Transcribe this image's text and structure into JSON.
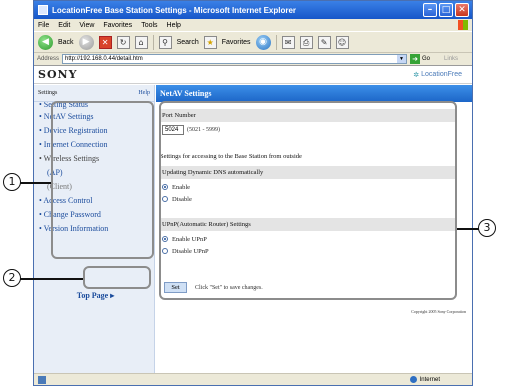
{
  "window": {
    "title": "LocationFree Base Station Settings - Microsoft Internet Explorer",
    "controls": {
      "minimize": "–",
      "maximize": "□",
      "close": "✕"
    }
  },
  "menubar": {
    "items": [
      "File",
      "Edit",
      "View",
      "Favorites",
      "Tools",
      "Help"
    ]
  },
  "toolbar": {
    "back": "Back",
    "search": "Search",
    "favorites": "Favorites"
  },
  "addressbar": {
    "label": "Address",
    "url": "http://192.168.0.44/detail.htm",
    "go": "Go",
    "links": "Links"
  },
  "brand": {
    "left": "SONY",
    "right": "LocationFree"
  },
  "sidebar": {
    "title": "Settings",
    "help": "Help",
    "items": [
      "• Setting Status",
      "• NetAV Settings",
      "• Device Registration",
      "• Internet Connection",
      "• Wireless Settings",
      "(AP)",
      "(Client)",
      "• Access Control",
      "• Change Password",
      "• Version Information"
    ],
    "top_page": "Top Page ▸"
  },
  "main": {
    "heading": "NetAV Settings",
    "port": {
      "title": "Port Number",
      "value": "5024",
      "range": "(5021 - 5999)"
    },
    "outside_title": "Settings for accessing to the Base Station from outside",
    "ddns": {
      "title": "Updating Dynamic DNS automatically",
      "enable": "Enable",
      "disable": "Disable",
      "selected": "Enable"
    },
    "upnp": {
      "title": "UPnP(Automatic Router) Settings",
      "enable": "Enable UPnP",
      "disable": "Disable UPnP",
      "selected": "Enable UPnP"
    },
    "set_button": "Set",
    "set_hint": "Click \"Set\" to save changes.",
    "copyright": "Copyright 2005 Sony Corporation"
  },
  "statusbar": {
    "zone": "Internet"
  },
  "callouts": [
    "1",
    "2",
    "3"
  ],
  "colors": {
    "header_blue": "#1c66c8",
    "sidebar_bg": "#e8eef7",
    "link": "#1a4b9c"
  }
}
